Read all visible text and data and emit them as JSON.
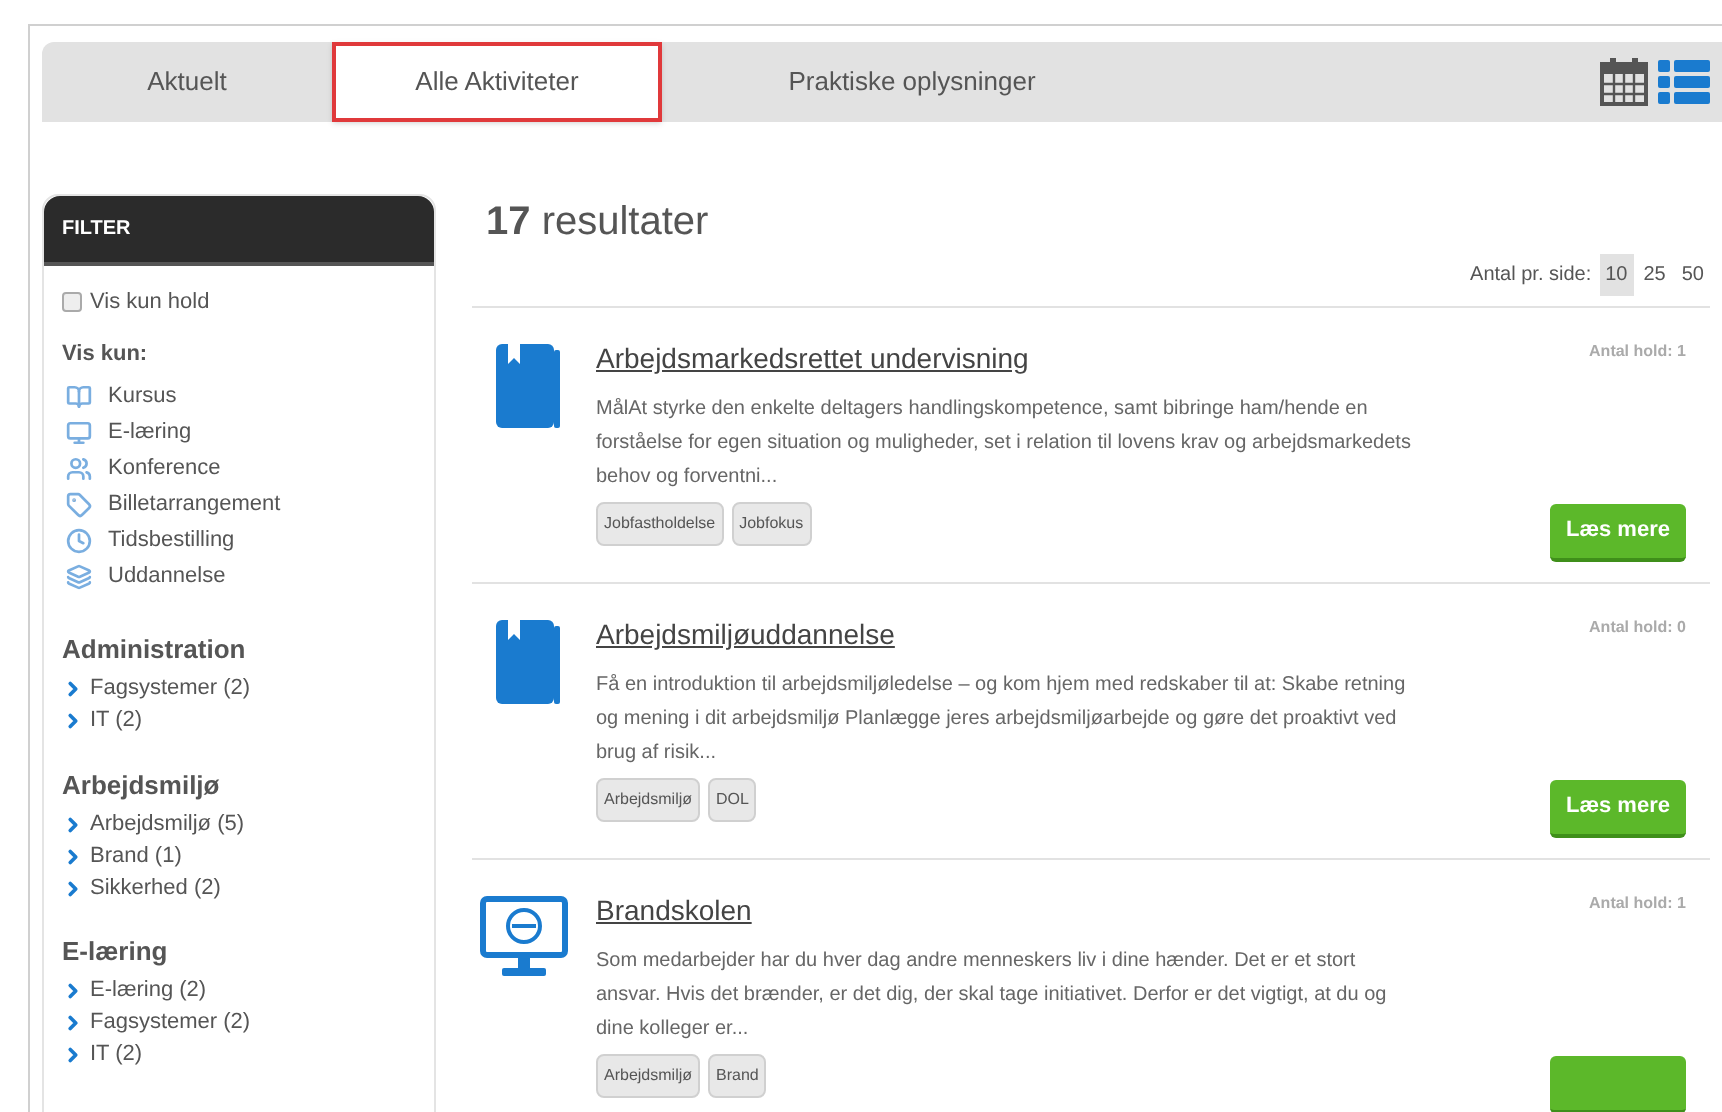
{
  "tabs": [
    {
      "label": "Aktuelt",
      "selected": false
    },
    {
      "label": "Alle Aktiviteter",
      "selected": true
    },
    {
      "label": "Praktiske oplysninger",
      "selected": false
    }
  ],
  "filter": {
    "title": "FILTER",
    "checkbox": {
      "label": "Vis kun hold",
      "checked": false
    },
    "types_label": "Vis kun:",
    "types": [
      {
        "label": "Kursus",
        "kind": "course"
      },
      {
        "label": "E-læring",
        "kind": "elearning"
      },
      {
        "label": "Konference",
        "kind": "conference"
      },
      {
        "label": "Billetarrangement",
        "kind": "ticket"
      },
      {
        "label": "Tidsbestilling",
        "kind": "booking"
      },
      {
        "label": "Uddannelse",
        "kind": "education"
      }
    ],
    "groups": [
      {
        "title": "Administration",
        "items": [
          "Fagsystemer (2)",
          "IT (2)"
        ]
      },
      {
        "title": "Arbejdsmiljø",
        "items": [
          "Arbejdsmiljø (5)",
          "Brand (1)",
          "Sikkerhed (2)"
        ]
      },
      {
        "title": "E-læring",
        "items": [
          "E-læring (2)",
          "Fagsystemer (2)",
          "IT (2)"
        ]
      }
    ]
  },
  "results": {
    "count": "17",
    "label": "resultater",
    "per_page_label": "Antal pr. side:",
    "per_page_options": [
      {
        "label": "10",
        "selected": true
      },
      {
        "label": "25",
        "selected": false
      },
      {
        "label": "50",
        "selected": false
      }
    ]
  },
  "items": [
    {
      "kind": "course",
      "title": "Arbejdsmarkedsrettet undervisning",
      "count_label": "Antal hold:",
      "count": "1",
      "description": "MålAt styrke den enkelte deltagers handlingskompetence, samt bibringe ham/hende en forståelse for egen situation og muligheder, set i relation til lovens krav og arbejdsmarkedets behov og forventni...",
      "tags": [
        "Jobfastholdelse",
        "Jobfokus"
      ],
      "button": "Læs mere"
    },
    {
      "kind": "course",
      "title": "Arbejdsmiljøuddannelse",
      "count_label": "Antal hold:",
      "count": "0",
      "description": "Få en introduktion til arbejdsmiljøledelse – og kom hjem med redskaber til at: Skabe retning og mening i dit arbejdsmiljø Planlægge jeres arbejdsmiljøarbejde og gøre det proaktivt ved brug af risik...",
      "tags": [
        "Arbejdsmiljø",
        "DOL"
      ],
      "button": "Læs mere"
    },
    {
      "kind": "elearning",
      "title": "Brandskolen",
      "count_label": "Antal hold:",
      "count": "1",
      "description": "Som medarbejder har du hver dag andre menneskers liv i dine hænder. Det er et stort ansvar. Hvis det brænder, er det dig, der skal tage initiativet. Derfor er det vigtigt, at du og dine kolleger er...",
      "tags": [
        "Arbejdsmiljø",
        "Brand"
      ]
    }
  ]
}
